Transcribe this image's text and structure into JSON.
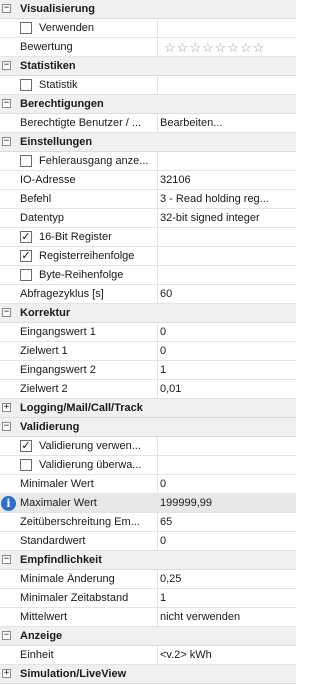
{
  "sections": {
    "visualisierung": "Visualisierung",
    "statistiken": "Statistiken",
    "berechtigungen": "Berechtigungen",
    "einstellungen": "Einstellungen",
    "korrektur": "Korrektur",
    "logging": "Logging/Mail/Call/Track",
    "validierung": "Validierung",
    "empfindlichkeit": "Empfindlichkeit",
    "anzeige": "Anzeige",
    "simulation": "Simulation/LiveView"
  },
  "expanders": {
    "expanded": "−",
    "collapsed": "+"
  },
  "check_mark": "✓",
  "info_glyph": "i",
  "rating": {
    "value": 0,
    "max": 8,
    "star_glyph": "☆"
  },
  "rows": {
    "verwenden": {
      "label": "Verwenden",
      "checked": false
    },
    "bewertung": {
      "label": "Bewertung"
    },
    "statistik": {
      "label": "Statistik",
      "checked": false
    },
    "berechtigte": {
      "label": "Berechtigte Benutzer / ...",
      "value": "Bearbeiten..."
    },
    "fehlerausgang": {
      "label": "Fehlerausgang anze...",
      "checked": false
    },
    "io_adresse": {
      "label": "IO-Adresse",
      "value": "32106"
    },
    "befehl": {
      "label": "Befehl",
      "value": "3 - Read holding reg..."
    },
    "datentyp": {
      "label": "Datentyp",
      "value": "32-bit signed integer"
    },
    "bit16": {
      "label": "16-Bit Register",
      "checked": true
    },
    "registerreihenfolge": {
      "label": "Registerreihenfolge",
      "checked": true
    },
    "bytereihenfolge": {
      "label": "Byte-Reihenfolge",
      "checked": false
    },
    "abfragezyklus": {
      "label": "Abfragezyklus [s]",
      "value": "60"
    },
    "eingangswert1": {
      "label": "Eingangswert 1",
      "value": "0"
    },
    "zielwert1": {
      "label": "Zielwert 1",
      "value": "0"
    },
    "eingangswert2": {
      "label": "Eingangswert 2",
      "value": "1"
    },
    "zielwert2": {
      "label": "Zielwert 2",
      "value": "0,01"
    },
    "validierung_verwenden": {
      "label": "Validierung verwen...",
      "checked": true
    },
    "validierung_ueberwa": {
      "label": "Validierung überwa...",
      "checked": false
    },
    "minimaler_wert": {
      "label": "Minimaler Wert",
      "value": "0"
    },
    "maximaler_wert": {
      "label": "Maximaler Wert",
      "value": "199999,99"
    },
    "zeitueberschreitung": {
      "label": "Zeitüberschreitung Em...",
      "value": "65"
    },
    "standardwert": {
      "label": "Standardwert",
      "value": "0"
    },
    "minimale_aenderung": {
      "label": "Minimale Änderung",
      "value": "0,25"
    },
    "minimaler_zeitabstand": {
      "label": "Minimaler Zeitabstand",
      "value": "1"
    },
    "mittelwert": {
      "label": "Mittelwert",
      "value": "nicht verwenden"
    },
    "einheit": {
      "label": "Einheit",
      "value": "<v.2> kWh"
    }
  }
}
